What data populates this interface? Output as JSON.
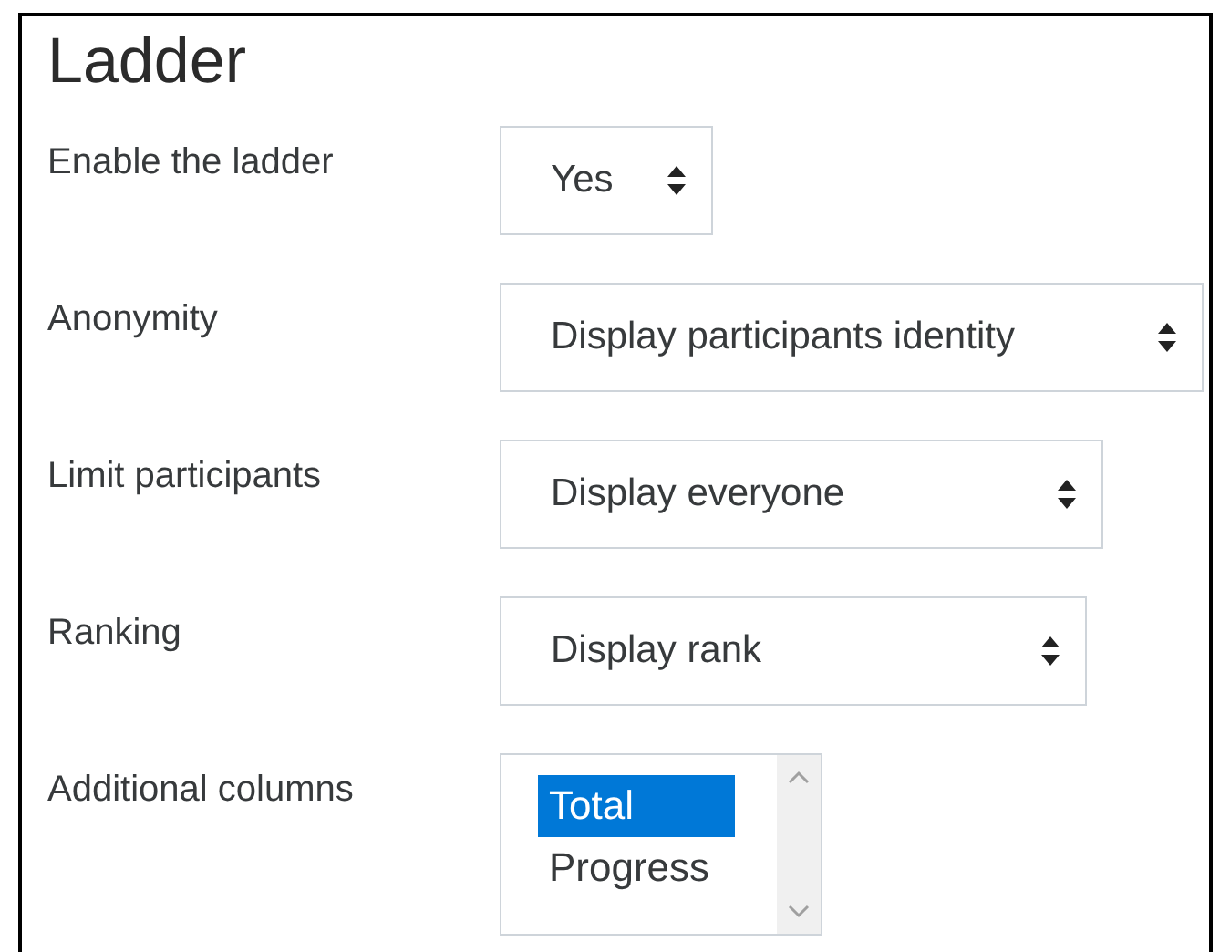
{
  "title": "Ladder",
  "fields": [
    {
      "kind": "select",
      "label": "Enable the ladder",
      "value": "Yes"
    },
    {
      "kind": "select",
      "label": "Anonymity",
      "value": "Display participants identity"
    },
    {
      "kind": "select",
      "label": "Limit participants",
      "value": "Display everyone"
    },
    {
      "kind": "select",
      "label": "Ranking",
      "value": "Display rank"
    },
    {
      "kind": "listbox",
      "label": "Additional columns",
      "options": [
        {
          "label": "Total",
          "selected": true
        },
        {
          "label": "Progress",
          "selected": false
        }
      ]
    }
  ]
}
